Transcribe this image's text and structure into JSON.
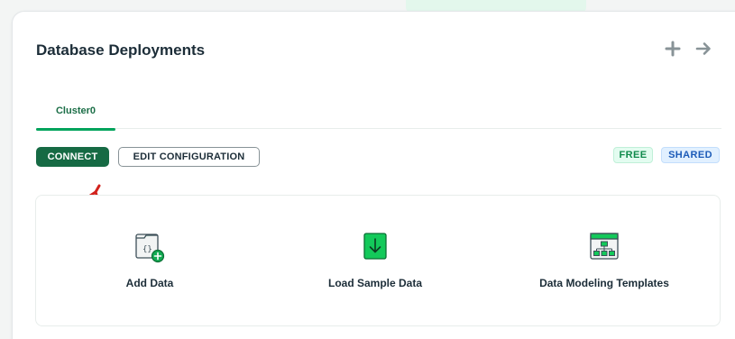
{
  "card": {
    "title": "Database Deployments"
  },
  "header_actions": {
    "add_icon": "plus-icon",
    "go_icon": "arrow-right-icon"
  },
  "tabs": [
    {
      "label": "Cluster0",
      "active": true
    }
  ],
  "toolbar": {
    "connect_label": "CONNECT",
    "edit_label": "EDIT CONFIGURATION"
  },
  "badges": {
    "free": "FREE",
    "shared": "SHARED"
  },
  "options": [
    {
      "label": "Add Data",
      "icon": "folder-add-icon"
    },
    {
      "label": "Load Sample Data",
      "icon": "download-icon"
    },
    {
      "label": "Data Modeling Templates",
      "icon": "schema-template-icon"
    }
  ],
  "colors": {
    "primary": "#166a44",
    "accent": "#00a35c",
    "annotation": "#d2221c"
  }
}
